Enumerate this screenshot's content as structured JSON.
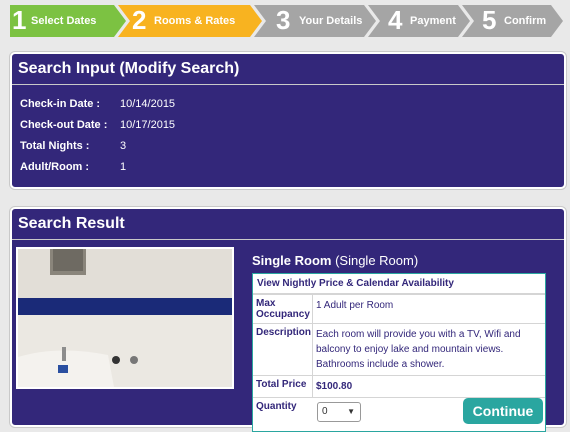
{
  "steps": [
    {
      "num": "1",
      "label": "Select Dates",
      "color": "#7cc242"
    },
    {
      "num": "2",
      "label": "Rooms & Rates",
      "color": "#f8b320"
    },
    {
      "num": "3",
      "label": "Your Details",
      "color": "#a5a5a5"
    },
    {
      "num": "4",
      "label": "Payment",
      "color": "#a5a5a5"
    },
    {
      "num": "5",
      "label": "Confirm",
      "color": "#a5a5a5"
    }
  ],
  "search_input": {
    "title": "Search Input (Modify Search)",
    "rows": [
      {
        "key": "Check-in Date :",
        "value": "10/14/2015"
      },
      {
        "key": "Check-out Date :",
        "value": "10/17/2015"
      },
      {
        "key": "Total Nights :",
        "value": "3"
      },
      {
        "key": "Adult/Room :",
        "value": "1"
      }
    ]
  },
  "search_result": {
    "title": "Search Result",
    "room_name": "Single Room",
    "room_type": "(Single Room)",
    "price_link": "View Nightly Price & Calendar Availability",
    "max_occupancy_label": "Max Occupancy",
    "max_occupancy_value": "1 Adult per Room",
    "description_label": "Description",
    "description_value": "Each room will provide you with a TV, Wifi and balcony to enjoy lake and mountain views. Bathrooms include a shower.",
    "total_price_label": "Total Price",
    "total_price_value": "$100.80",
    "quantity_label": "Quantity",
    "quantity_value": "0",
    "continue_label": "Continue"
  },
  "colors": {
    "panel": "#33277a",
    "accent": "#2aa6a0"
  }
}
